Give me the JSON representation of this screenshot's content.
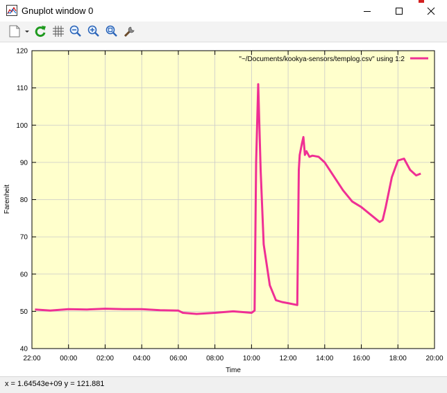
{
  "window": {
    "title": "Gnuplot window 0"
  },
  "toolbar": {
    "buttons": [
      {
        "icon": "copy-icon",
        "label": "Copy to clipboard"
      },
      {
        "icon": "replot-icon",
        "label": "Replot"
      },
      {
        "icon": "grid-icon",
        "label": "Toggle grid"
      },
      {
        "icon": "zoom-previous-icon",
        "label": "Previous zoom"
      },
      {
        "icon": "zoom-next-icon",
        "label": "Next zoom"
      },
      {
        "icon": "autoscale-icon",
        "label": "Autoscale"
      },
      {
        "icon": "settings-icon",
        "label": "Options"
      }
    ]
  },
  "status": {
    "coords": "x = 1.64543e+09 y = 121.881"
  },
  "colors": {
    "plot_background": "#ffffcc",
    "series": "#ef2f94",
    "grid": "#c9c9c9"
  },
  "chart_data": {
    "type": "line",
    "title": "",
    "xlabel": "Time",
    "ylabel": "Farenheit",
    "xlim": [
      "22:00",
      "20:00"
    ],
    "ylim": [
      40,
      120
    ],
    "grid": true,
    "legend_position": "top-right",
    "x_ticks": [
      "22:00",
      "00:00",
      "02:00",
      "04:00",
      "06:00",
      "08:00",
      "10:00",
      "12:00",
      "14:00",
      "16:00",
      "18:00",
      "20:00"
    ],
    "y_ticks": [
      40,
      50,
      60,
      70,
      80,
      90,
      100,
      110,
      120
    ],
    "series": [
      {
        "name": "\"~/Documents/kookya-sensors/templog.csv\" using 1:2",
        "x": [
          "22:10",
          "23:00",
          "00:00",
          "01:00",
          "02:00",
          "03:00",
          "04:00",
          "05:00",
          "06:00",
          "06:15",
          "07:00",
          "08:00",
          "09:00",
          "10:00",
          "10:10",
          "10:15",
          "10:22",
          "10:30",
          "10:40",
          "11:00",
          "11:20",
          "11:40",
          "12:00",
          "12:30",
          "12:35",
          "12:38",
          "12:45",
          "12:50",
          "12:55",
          "13:00",
          "13:10",
          "13:20",
          "13:40",
          "14:00",
          "14:20",
          "14:40",
          "15:00",
          "15:30",
          "16:00",
          "16:30",
          "17:00",
          "17:10",
          "17:20",
          "17:40",
          "18:00",
          "18:20",
          "18:40",
          "19:00",
          "19:15"
        ],
        "y": [
          50.5,
          50.2,
          50.6,
          50.5,
          50.7,
          50.6,
          50.6,
          50.3,
          50.2,
          49.6,
          49.3,
          49.6,
          50.0,
          49.6,
          50.2,
          90,
          111,
          88,
          68,
          57,
          53,
          52.5,
          52.2,
          51.7,
          88,
          92,
          95,
          96.8,
          92,
          93,
          91.5,
          91.8,
          91.5,
          90,
          87.5,
          85,
          82.5,
          79.5,
          78,
          76,
          74,
          74.5,
          78,
          86,
          90.5,
          91,
          88,
          86.5,
          87
        ]
      }
    ]
  }
}
